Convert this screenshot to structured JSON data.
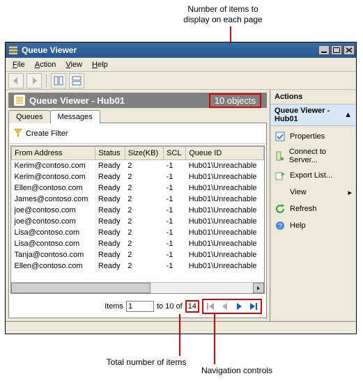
{
  "window": {
    "title": "Queue Viewer"
  },
  "menubar": {
    "file_u": "F",
    "file_r": "ile",
    "action_u": "A",
    "action_r": "ction",
    "view_u": "V",
    "view_r": "iew",
    "help_u": "H",
    "help_r": "elp"
  },
  "header": {
    "title": "Queue Viewer - Hub01",
    "object_count_text": "10 objects"
  },
  "tabs": [
    "Queues",
    "Messages"
  ],
  "filter": {
    "label": "Create Filter"
  },
  "table": {
    "columns": [
      "From Address",
      "Status",
      "Size(KB)",
      "SCL",
      "Queue ID"
    ],
    "rows": [
      {
        "from": "Kerim@contoso.com",
        "status": "Ready",
        "size": "2",
        "scl": "-1",
        "queue": "Hub01\\Unreachable"
      },
      {
        "from": "Kerim@contoso.com",
        "status": "Ready",
        "size": "2",
        "scl": "-1",
        "queue": "Hub01\\Unreachable"
      },
      {
        "from": "Ellen@contoso.com",
        "status": "Ready",
        "size": "2",
        "scl": "-1",
        "queue": "Hub01\\Unreachable"
      },
      {
        "from": "James@contoso.com",
        "status": "Ready",
        "size": "2",
        "scl": "-1",
        "queue": "Hub01\\Unreachable"
      },
      {
        "from": "joe@contoso.com",
        "status": "Ready",
        "size": "2",
        "scl": "-1",
        "queue": "Hub01\\Unreachable"
      },
      {
        "from": "joe@contoso.com",
        "status": "Ready",
        "size": "2",
        "scl": "-1",
        "queue": "Hub01\\Unreachable"
      },
      {
        "from": "Lisa@contoso.com",
        "status": "Ready",
        "size": "2",
        "scl": "-1",
        "queue": "Hub01\\Unreachable"
      },
      {
        "from": "Lisa@contoso.com",
        "status": "Ready",
        "size": "2",
        "scl": "-1",
        "queue": "Hub01\\Unreachable"
      },
      {
        "from": "Tanja@contoso.com",
        "status": "Ready",
        "size": "2",
        "scl": "-1",
        "queue": "Hub01\\Unreachable"
      },
      {
        "from": "Ellen@contoso.com",
        "status": "Ready",
        "size": "2",
        "scl": "-1",
        "queue": "Hub01\\Unreachable"
      }
    ]
  },
  "pager": {
    "items_label": "Items",
    "from": "1",
    "to_label": "to",
    "to": "10",
    "of_label": "of",
    "total": "14"
  },
  "actions": {
    "header": "Actions",
    "subheader": "Queue Viewer - Hub01",
    "items": [
      "Properties",
      "Connect to Server...",
      "Export List...",
      "View",
      "Refresh",
      "Help"
    ]
  },
  "annotations": {
    "top1": "Number of items to",
    "top2": "display on each page",
    "bottom1": "Total number of items",
    "bottom2": "Navigation controls"
  }
}
